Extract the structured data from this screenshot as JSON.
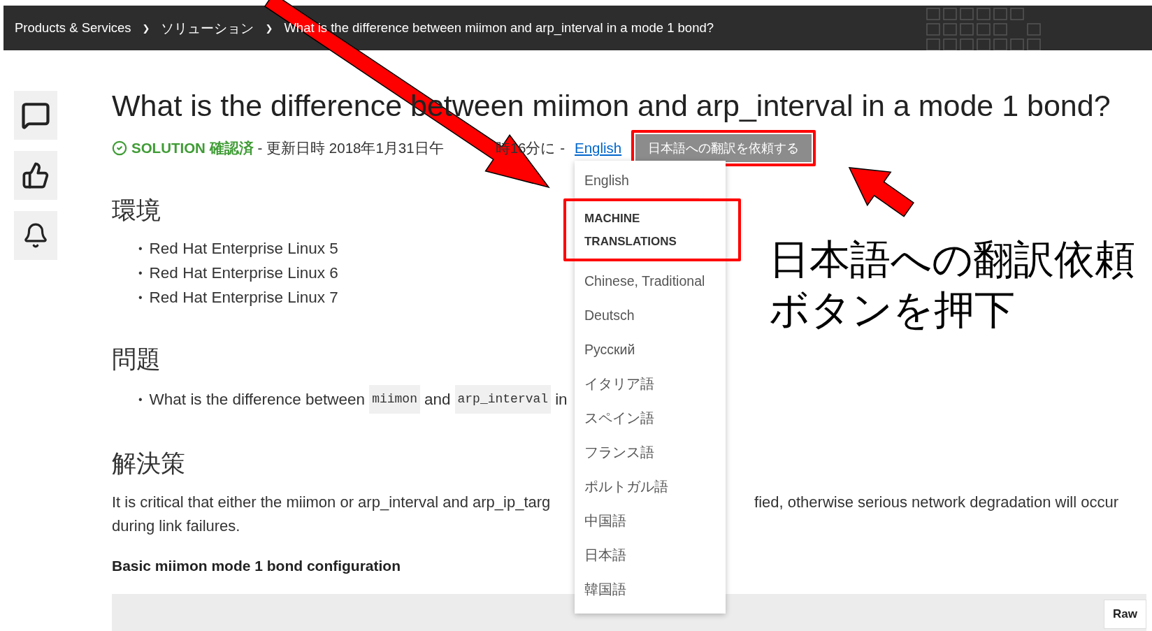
{
  "breadcrumb": {
    "separator": "❯",
    "items": [
      {
        "label": "Products & Services"
      },
      {
        "label": "ソリューション"
      },
      {
        "label": "What is the difference between miimon and arp_interval in a mode 1 bond?"
      }
    ]
  },
  "side_actions": [
    {
      "kind": "comment"
    },
    {
      "kind": "rate"
    },
    {
      "kind": "notify"
    }
  ],
  "article": {
    "title": "What is the difference between miimon and arp_interval in a mode 1 bond?",
    "status": "SOLUTION 確認済",
    "meta_before": "- 更新日時 2018年1月31日午",
    "meta_after": "時16分に -",
    "language_link": "English",
    "request_button": "日本語への翻訳を依頼する",
    "language_menu": [
      {
        "kind": "option",
        "label": "English"
      },
      {
        "kind": "header",
        "label": "MACHINE TRANSLATIONS"
      },
      {
        "kind": "option",
        "label": "Chinese, Traditional"
      },
      {
        "kind": "option",
        "label": "Deutsch"
      },
      {
        "kind": "option",
        "label": "Русский"
      },
      {
        "kind": "option",
        "label": "イタリア語"
      },
      {
        "kind": "option",
        "label": "スペイン語"
      },
      {
        "kind": "option",
        "label": "フランス語"
      },
      {
        "kind": "option",
        "label": "ポルトガル語"
      },
      {
        "kind": "option",
        "label": "中国語"
      },
      {
        "kind": "option",
        "label": "日本語"
      },
      {
        "kind": "option",
        "label": "韓国語"
      }
    ],
    "sections": [
      {
        "heading": "環境",
        "blocks": [
          {
            "kind": "list",
            "bullet": "•",
            "items": [
              [
                {
                  "kind": "text",
                  "text": "Red Hat Enterprise Linux 5"
                }
              ],
              [
                {
                  "kind": "text",
                  "text": "Red Hat Enterprise Linux 6"
                }
              ],
              [
                {
                  "kind": "text",
                  "text": "Red Hat Enterprise Linux 7"
                }
              ]
            ]
          }
        ]
      },
      {
        "heading": "問題",
        "blocks": [
          {
            "kind": "list",
            "bullet": "•",
            "items": [
              [
                {
                  "kind": "text",
                  "text": "What is the difference between"
                },
                {
                  "kind": "code",
                  "text": "miimon"
                },
                {
                  "kind": "text",
                  "text": "and"
                },
                {
                  "kind": "code",
                  "text": "arp_interval"
                },
                {
                  "kind": "text",
                  "text": "in"
                }
              ]
            ]
          }
        ]
      },
      {
        "heading": "解決策",
        "blocks": [
          {
            "kind": "paragraph",
            "lines": [
              [
                "It is critical that either the miimon or arp_interval and arp_ip_targ",
                "fied, otherwise serious network degradation will occur"
              ],
              [
                "during link failures."
              ]
            ]
          },
          {
            "kind": "subheading",
            "text": "Basic miimon mode 1 bond configuration"
          },
          {
            "kind": "code_block",
            "button": "Raw"
          }
        ]
      }
    ]
  },
  "annotation": {
    "lines": [
      "日本語への翻訳依頼",
      "ボタンを押下"
    ]
  }
}
